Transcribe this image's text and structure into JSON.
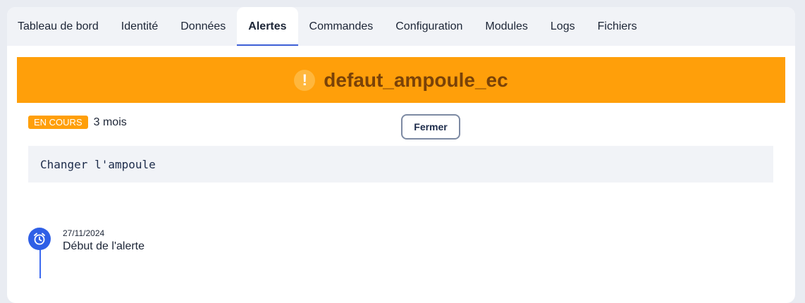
{
  "tabs": [
    {
      "label": "Tableau de bord",
      "active": false
    },
    {
      "label": "Identité",
      "active": false
    },
    {
      "label": "Données",
      "active": false
    },
    {
      "label": "Alertes",
      "active": true
    },
    {
      "label": "Commandes",
      "active": false
    },
    {
      "label": "Configuration",
      "active": false
    },
    {
      "label": "Modules",
      "active": false
    },
    {
      "label": "Logs",
      "active": false
    },
    {
      "label": "Fichiers",
      "active": false
    }
  ],
  "alert": {
    "title": "defaut_ampoule_ec",
    "icon": "warning-icon",
    "icon_glyph": "!",
    "banner_color": "#ff9f0a",
    "status_badge": "EN COURS",
    "age": "3 mois",
    "close_label": "Fermer",
    "message": "Changer l'ampoule"
  },
  "timeline": [
    {
      "date": "27/11/2024",
      "label": "Début de l'alerte",
      "icon": "alarm-clock-icon"
    }
  ],
  "colors": {
    "accent": "#3d5fd6",
    "warning": "#ff9f0a",
    "timeline": "#2f5fe6"
  }
}
